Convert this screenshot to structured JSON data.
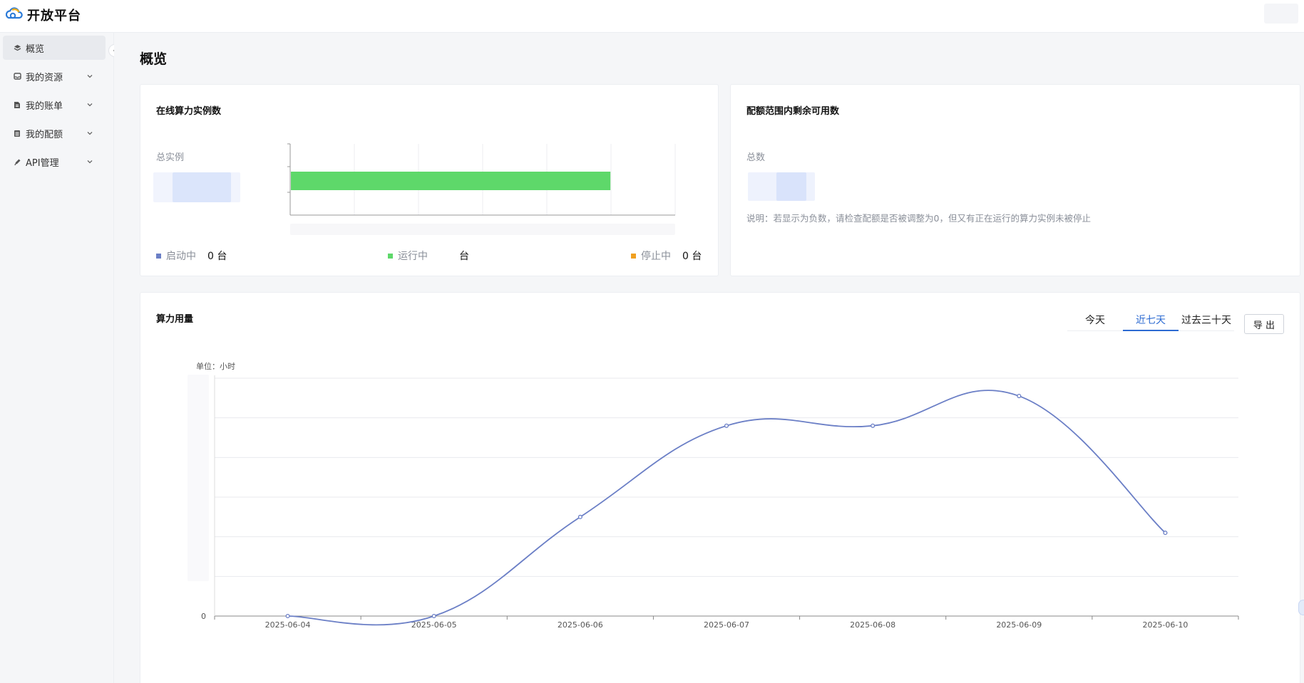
{
  "app": {
    "title": "开放平台"
  },
  "sidebar": {
    "items": [
      {
        "label": "概览",
        "icon": "layers-icon",
        "active": true
      },
      {
        "label": "我的资源",
        "icon": "inbox-icon",
        "expandable": true
      },
      {
        "label": "我的账单",
        "icon": "document-icon",
        "expandable": true
      },
      {
        "label": "我的配额",
        "icon": "list-icon",
        "expandable": true
      },
      {
        "label": "API管理",
        "icon": "pen-icon",
        "expandable": true
      }
    ]
  },
  "page": {
    "title": "概览"
  },
  "online_card": {
    "title": "在线算力实例数",
    "total_label": "总实例",
    "legend": [
      {
        "label": "启动中",
        "value": "0 台",
        "color": "#6b7fc6"
      },
      {
        "label": "运行中",
        "value": "台",
        "color": "#5ed86a"
      },
      {
        "label": "停止中",
        "value": "0 台",
        "color": "#f0a020"
      }
    ]
  },
  "quota_card": {
    "title": "配额范围内剩余可用数",
    "total_label": "总数",
    "note": "说明：若显示为负数，请检查配额是否被调整为0，但又有正在运行的算力实例未被停止"
  },
  "usage_card": {
    "title": "算力用量",
    "tabs": [
      "今天",
      "近七天",
      "过去三十天"
    ],
    "active_tab": 1,
    "export_label": "导 出",
    "unit_label": "单位：小时"
  },
  "colors": {
    "accent": "#2d6bd2",
    "line": "#6b7fc6",
    "bar": "#5ed86a"
  },
  "chart_data": [
    {
      "type": "bar",
      "orientation": "horizontal",
      "series": [
        {
          "name": "运行中",
          "values": [
            0.83
          ]
        }
      ],
      "xlim": [
        0,
        1
      ],
      "grid": true
    },
    {
      "type": "line",
      "smooth": true,
      "categories": [
        "2025-06-04",
        "2025-06-05",
        "2025-06-06",
        "2025-06-07",
        "2025-06-08",
        "2025-06-09",
        "2025-06-10"
      ],
      "values": [
        0,
        0,
        2.5,
        4.8,
        4.8,
        5.55,
        2.1
      ],
      "ylim": [
        0,
        6
      ],
      "y_ticks": [
        "0"
      ],
      "ylabel": "单位：小时",
      "grid": true
    }
  ]
}
